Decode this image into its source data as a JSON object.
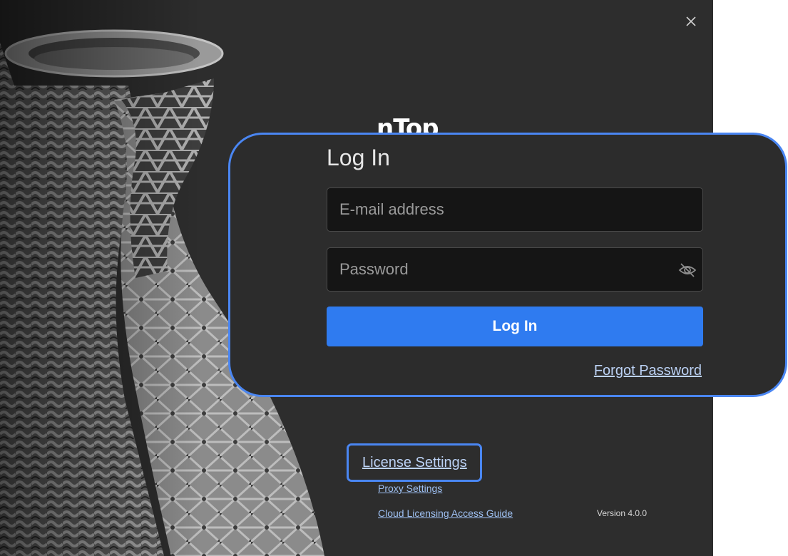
{
  "window": {
    "close_icon": "close-icon",
    "brand": "nTop"
  },
  "login": {
    "title": "Log In",
    "email_placeholder": "E-mail address",
    "email_value": "",
    "password_placeholder": "Password",
    "password_value": "",
    "password_visibility_icon": "eye-off-icon",
    "submit_label": "Log In",
    "forgot_label": "Forgot Password"
  },
  "footer": {
    "license_settings_label": "License Settings",
    "proxy_settings_label": "Proxy Settings",
    "cloud_guide_label": "Cloud Licensing Access Guide",
    "version_label": "Version 4.0.0"
  },
  "colors": {
    "accent": "#2f7bf0",
    "highlight": "#4a86f2",
    "background": "#2d2d2d",
    "input_background": "#151515",
    "link": "#bcd2f5"
  }
}
